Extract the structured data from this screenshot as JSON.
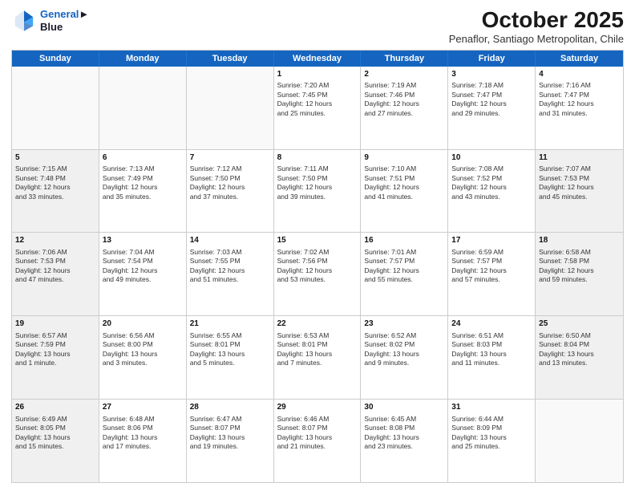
{
  "header": {
    "logo_line1": "General",
    "logo_line2": "Blue",
    "month_title": "October 2025",
    "location": "Penaflor, Santiago Metropolitan, Chile"
  },
  "days_of_week": [
    "Sunday",
    "Monday",
    "Tuesday",
    "Wednesday",
    "Thursday",
    "Friday",
    "Saturday"
  ],
  "weeks": [
    [
      {
        "day": "",
        "info": "",
        "empty": true
      },
      {
        "day": "",
        "info": "",
        "empty": true
      },
      {
        "day": "",
        "info": "",
        "empty": true
      },
      {
        "day": "1",
        "info": "Sunrise: 7:20 AM\nSunset: 7:45 PM\nDaylight: 12 hours\nand 25 minutes."
      },
      {
        "day": "2",
        "info": "Sunrise: 7:19 AM\nSunset: 7:46 PM\nDaylight: 12 hours\nand 27 minutes."
      },
      {
        "day": "3",
        "info": "Sunrise: 7:18 AM\nSunset: 7:47 PM\nDaylight: 12 hours\nand 29 minutes."
      },
      {
        "day": "4",
        "info": "Sunrise: 7:16 AM\nSunset: 7:47 PM\nDaylight: 12 hours\nand 31 minutes."
      }
    ],
    [
      {
        "day": "5",
        "info": "Sunrise: 7:15 AM\nSunset: 7:48 PM\nDaylight: 12 hours\nand 33 minutes.",
        "shaded": true
      },
      {
        "day": "6",
        "info": "Sunrise: 7:13 AM\nSunset: 7:49 PM\nDaylight: 12 hours\nand 35 minutes."
      },
      {
        "day": "7",
        "info": "Sunrise: 7:12 AM\nSunset: 7:50 PM\nDaylight: 12 hours\nand 37 minutes."
      },
      {
        "day": "8",
        "info": "Sunrise: 7:11 AM\nSunset: 7:50 PM\nDaylight: 12 hours\nand 39 minutes."
      },
      {
        "day": "9",
        "info": "Sunrise: 7:10 AM\nSunset: 7:51 PM\nDaylight: 12 hours\nand 41 minutes."
      },
      {
        "day": "10",
        "info": "Sunrise: 7:08 AM\nSunset: 7:52 PM\nDaylight: 12 hours\nand 43 minutes."
      },
      {
        "day": "11",
        "info": "Sunrise: 7:07 AM\nSunset: 7:53 PM\nDaylight: 12 hours\nand 45 minutes.",
        "shaded": true
      }
    ],
    [
      {
        "day": "12",
        "info": "Sunrise: 7:06 AM\nSunset: 7:53 PM\nDaylight: 12 hours\nand 47 minutes.",
        "shaded": true
      },
      {
        "day": "13",
        "info": "Sunrise: 7:04 AM\nSunset: 7:54 PM\nDaylight: 12 hours\nand 49 minutes."
      },
      {
        "day": "14",
        "info": "Sunrise: 7:03 AM\nSunset: 7:55 PM\nDaylight: 12 hours\nand 51 minutes."
      },
      {
        "day": "15",
        "info": "Sunrise: 7:02 AM\nSunset: 7:56 PM\nDaylight: 12 hours\nand 53 minutes."
      },
      {
        "day": "16",
        "info": "Sunrise: 7:01 AM\nSunset: 7:57 PM\nDaylight: 12 hours\nand 55 minutes."
      },
      {
        "day": "17",
        "info": "Sunrise: 6:59 AM\nSunset: 7:57 PM\nDaylight: 12 hours\nand 57 minutes."
      },
      {
        "day": "18",
        "info": "Sunrise: 6:58 AM\nSunset: 7:58 PM\nDaylight: 12 hours\nand 59 minutes.",
        "shaded": true
      }
    ],
    [
      {
        "day": "19",
        "info": "Sunrise: 6:57 AM\nSunset: 7:59 PM\nDaylight: 13 hours\nand 1 minute.",
        "shaded": true
      },
      {
        "day": "20",
        "info": "Sunrise: 6:56 AM\nSunset: 8:00 PM\nDaylight: 13 hours\nand 3 minutes."
      },
      {
        "day": "21",
        "info": "Sunrise: 6:55 AM\nSunset: 8:01 PM\nDaylight: 13 hours\nand 5 minutes."
      },
      {
        "day": "22",
        "info": "Sunrise: 6:53 AM\nSunset: 8:01 PM\nDaylight: 13 hours\nand 7 minutes."
      },
      {
        "day": "23",
        "info": "Sunrise: 6:52 AM\nSunset: 8:02 PM\nDaylight: 13 hours\nand 9 minutes."
      },
      {
        "day": "24",
        "info": "Sunrise: 6:51 AM\nSunset: 8:03 PM\nDaylight: 13 hours\nand 11 minutes."
      },
      {
        "day": "25",
        "info": "Sunrise: 6:50 AM\nSunset: 8:04 PM\nDaylight: 13 hours\nand 13 minutes.",
        "shaded": true
      }
    ],
    [
      {
        "day": "26",
        "info": "Sunrise: 6:49 AM\nSunset: 8:05 PM\nDaylight: 13 hours\nand 15 minutes.",
        "shaded": true
      },
      {
        "day": "27",
        "info": "Sunrise: 6:48 AM\nSunset: 8:06 PM\nDaylight: 13 hours\nand 17 minutes."
      },
      {
        "day": "28",
        "info": "Sunrise: 6:47 AM\nSunset: 8:07 PM\nDaylight: 13 hours\nand 19 minutes."
      },
      {
        "day": "29",
        "info": "Sunrise: 6:46 AM\nSunset: 8:07 PM\nDaylight: 13 hours\nand 21 minutes."
      },
      {
        "day": "30",
        "info": "Sunrise: 6:45 AM\nSunset: 8:08 PM\nDaylight: 13 hours\nand 23 minutes."
      },
      {
        "day": "31",
        "info": "Sunrise: 6:44 AM\nSunset: 8:09 PM\nDaylight: 13 hours\nand 25 minutes."
      },
      {
        "day": "",
        "info": "",
        "empty": true
      }
    ]
  ]
}
